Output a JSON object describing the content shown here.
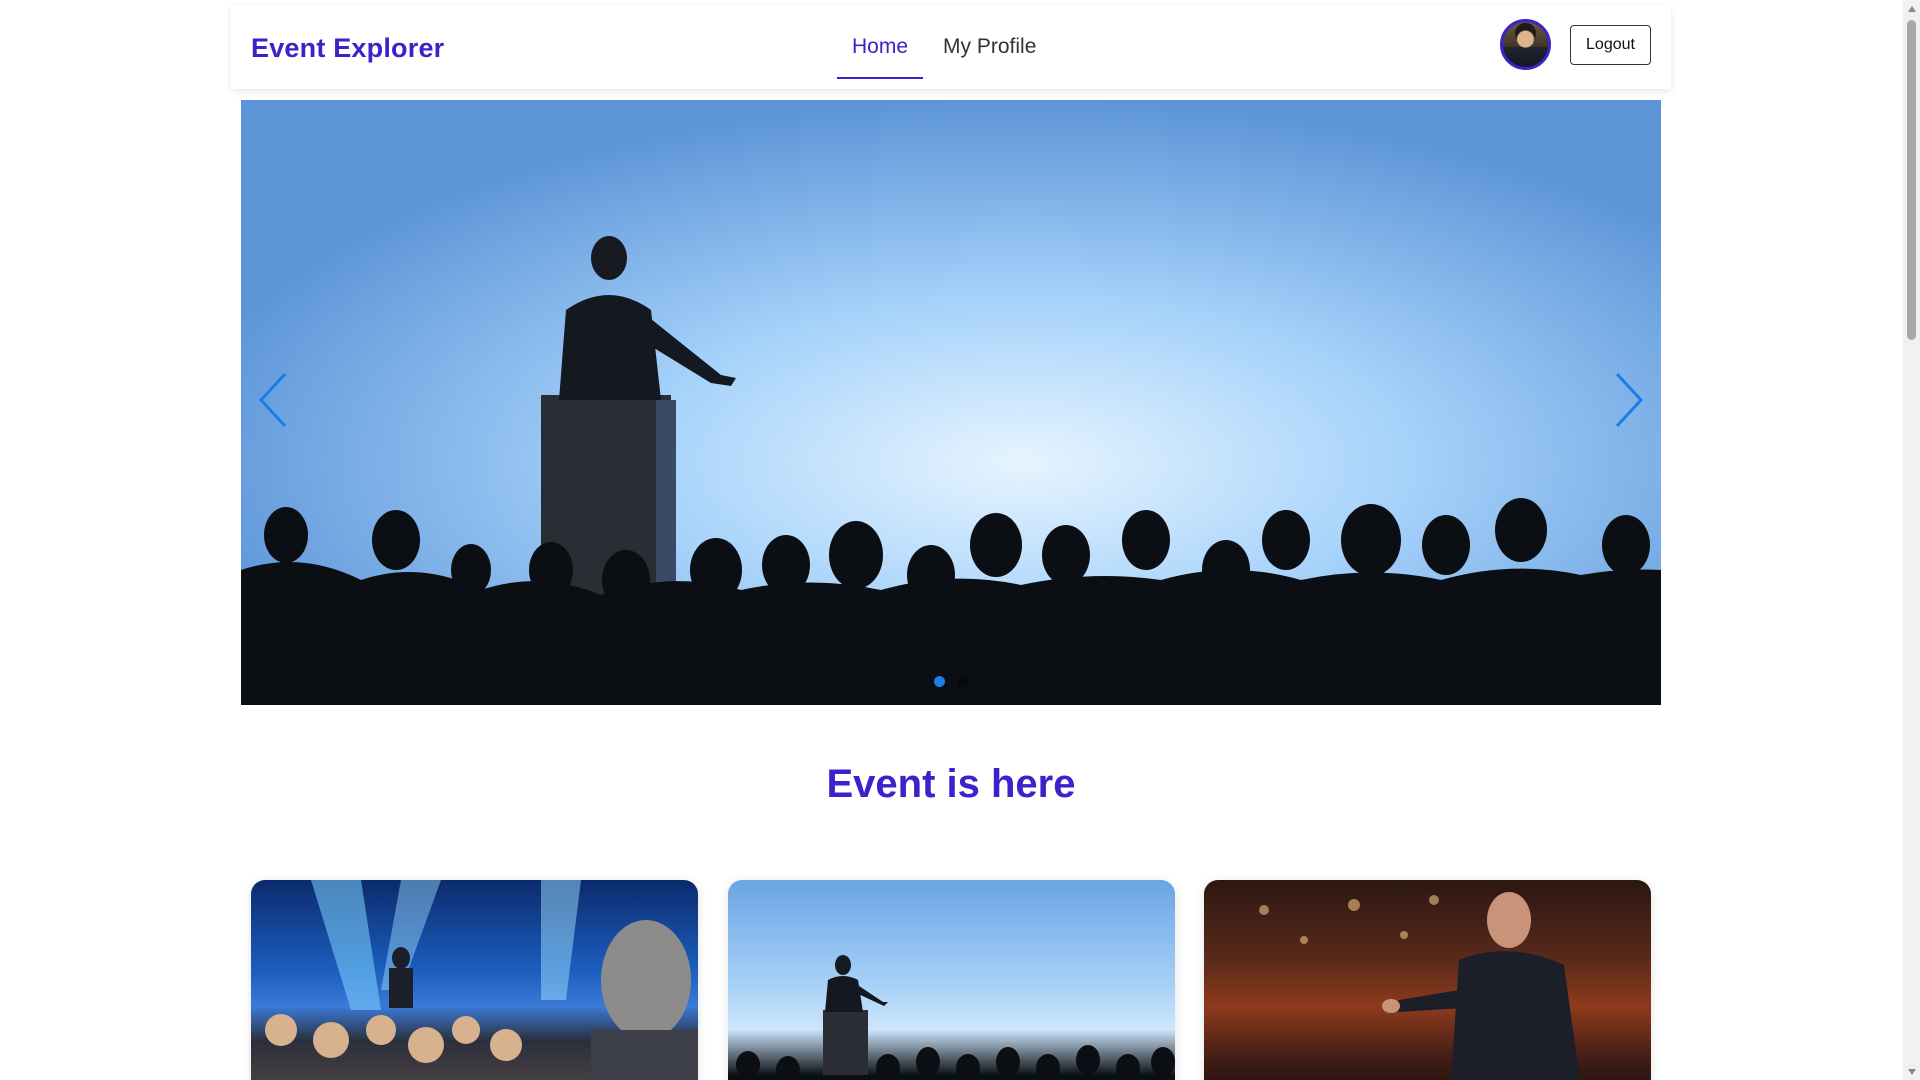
{
  "navbar": {
    "brand": "Event Explorer",
    "links": [
      {
        "label": "Home",
        "active": true
      },
      {
        "label": "My Profile",
        "active": false
      }
    ],
    "logout_label": "Logout",
    "avatar_icon": "user-avatar-icon"
  },
  "carousel": {
    "slide_count": 2,
    "active_slide": 1,
    "prev_icon": "chevron-left-icon",
    "next_icon": "chevron-right-icon"
  },
  "section": {
    "title": "Event is here"
  },
  "cards": [
    {
      "image": "conference-audience-stage-lights"
    },
    {
      "image": "speaker-podium-silhouette"
    },
    {
      "image": "speaker-gesturing-theater"
    }
  ],
  "colors": {
    "brand": "#3b22c9",
    "carousel_indicator_active": "#1a7ee8",
    "arrow": "#1a7ee8"
  }
}
